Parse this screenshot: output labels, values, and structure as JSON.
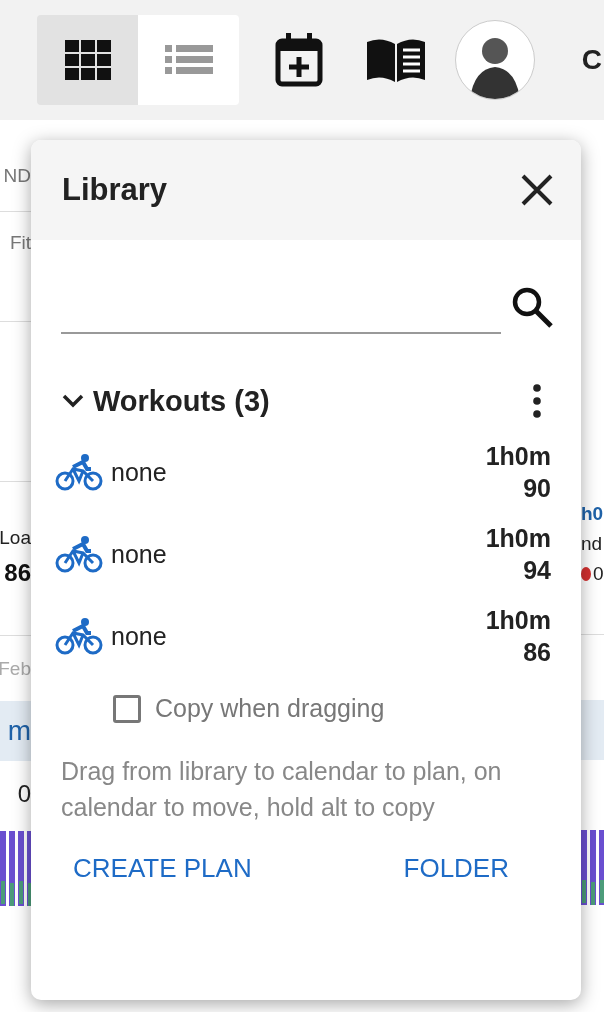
{
  "toolbar": {
    "views": [
      {
        "kind": "grid",
        "selected": true
      },
      {
        "kind": "list",
        "selected": false
      }
    ],
    "edge_text": "C"
  },
  "background": {
    "left": {
      "header": "ND",
      "tab": "Fit",
      "load_label": "Loa",
      "load_value": "86",
      "date": "Feb",
      "band_text": "m",
      "value": "0"
    },
    "right": {
      "link": "h0",
      "label": "nd",
      "status": {
        "text": "0",
        "color": "#d32f2f"
      }
    }
  },
  "library": {
    "title": "Library",
    "folder": {
      "name": "Workouts (3)",
      "expanded": true
    },
    "workouts": [
      {
        "name": "none",
        "duration": "1h0m",
        "load": "90"
      },
      {
        "name": "none",
        "duration": "1h0m",
        "load": "94"
      },
      {
        "name": "none",
        "duration": "1h0m",
        "load": "86"
      }
    ],
    "copy_when_dragging": {
      "label": "Copy when dragging",
      "checked": false
    },
    "help": "Drag from library to calendar to plan, on calendar to move, hold alt to copy",
    "buttons": [
      "CREATE PLAN",
      "FOLDER"
    ]
  }
}
